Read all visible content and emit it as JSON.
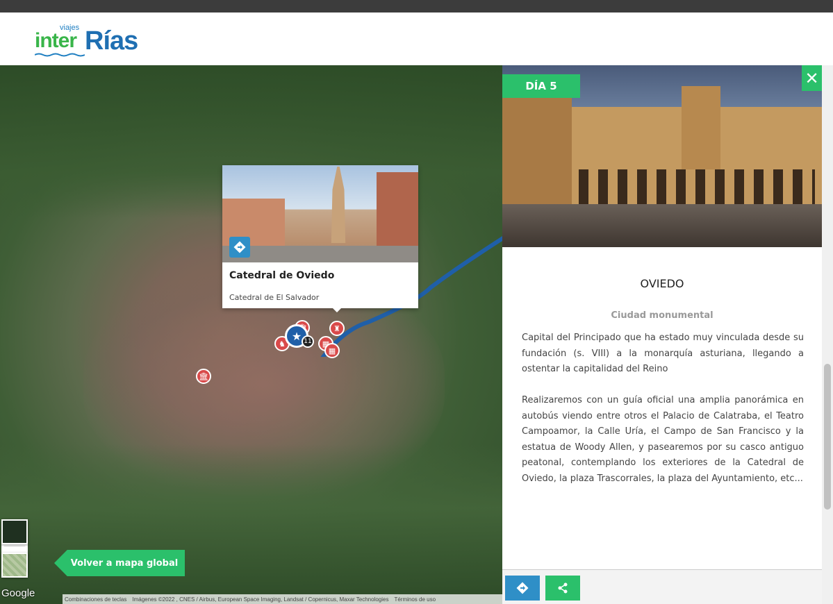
{
  "header": {
    "logo_small": "viajes",
    "logo_inter": "inter",
    "logo_rias": "Rías"
  },
  "map": {
    "popup": {
      "title": "Catedral de Oviedo",
      "subtitle": "Catedral de El Salvador"
    },
    "cluster_count": "11",
    "zoom_in": "+",
    "zoom_out": "−",
    "back_button": "Volver a mapa global",
    "google_label": "Google",
    "attribution": {
      "shortcuts": "Combinaciones de teclas",
      "imagery": "Imágenes ©2022 , CNES / Airbus, European Space Imaging, Landsat / Copernicus, Maxar Technologies",
      "terms": "Términos de uso"
    }
  },
  "panel": {
    "day_badge": "DÍA 5",
    "close_icon": "✕",
    "city": "OVIEDO",
    "tagline": "Ciudad monumental",
    "description_1": "Capital del Principado que ha estado muy vinculada desde su fundación (s. VIII) a la monarquía asturiana, llegando a ostentar la capitalidad del Reino",
    "description_2": "Realizaremos con un guía oficial una amplia panorámica en autobús viendo entre otros el Palacio de Calatraba, el Teatro Campoamor, la Calle Uría, el Campo de San Francisco y la estatua de Woody Allen, y pasearemos por su casco antiguo peatonal, contemplando los exteriores de la Catedral de Oviedo, la plaza Trascorrales, la plaza del Ayuntamiento, etc..."
  },
  "colors": {
    "accent_green": "#2bc06b",
    "accent_blue": "#2f8fc7",
    "marker_red": "#d94a4a",
    "route_blue": "#1f5fa8"
  }
}
